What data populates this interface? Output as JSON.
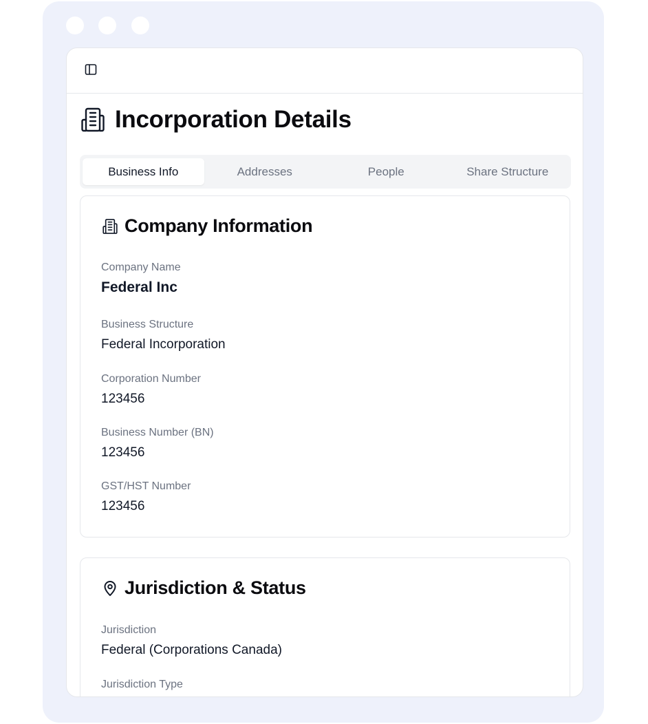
{
  "page": {
    "title": "Incorporation Details"
  },
  "tabs": [
    {
      "label": "Business Info",
      "active": true
    },
    {
      "label": "Addresses",
      "active": false
    },
    {
      "label": "People",
      "active": false
    },
    {
      "label": "Share Structure",
      "active": false
    }
  ],
  "company_info": {
    "title": "Company Information",
    "icon": "building-icon",
    "fields": [
      {
        "label": "Company Name",
        "value": "Federal Inc"
      },
      {
        "label": "Business Structure",
        "value": "Federal Incorporation"
      },
      {
        "label": "Corporation Number",
        "value": "123456"
      },
      {
        "label": "Business Number (BN)",
        "value": "123456"
      },
      {
        "label": "GST/HST Number",
        "value": "123456"
      }
    ]
  },
  "jurisdiction": {
    "title": "Jurisdiction & Status",
    "icon": "map-pin-icon",
    "fields": [
      {
        "label": "Jurisdiction",
        "value": "Federal (Corporations Canada)"
      },
      {
        "label": "Jurisdiction Type",
        "value": ""
      }
    ]
  },
  "colors": {
    "frame_background": "#eef1fb",
    "tab_bar_background": "#f3f4f6",
    "label_gray": "#6b7280",
    "text_dark": "#111827"
  }
}
